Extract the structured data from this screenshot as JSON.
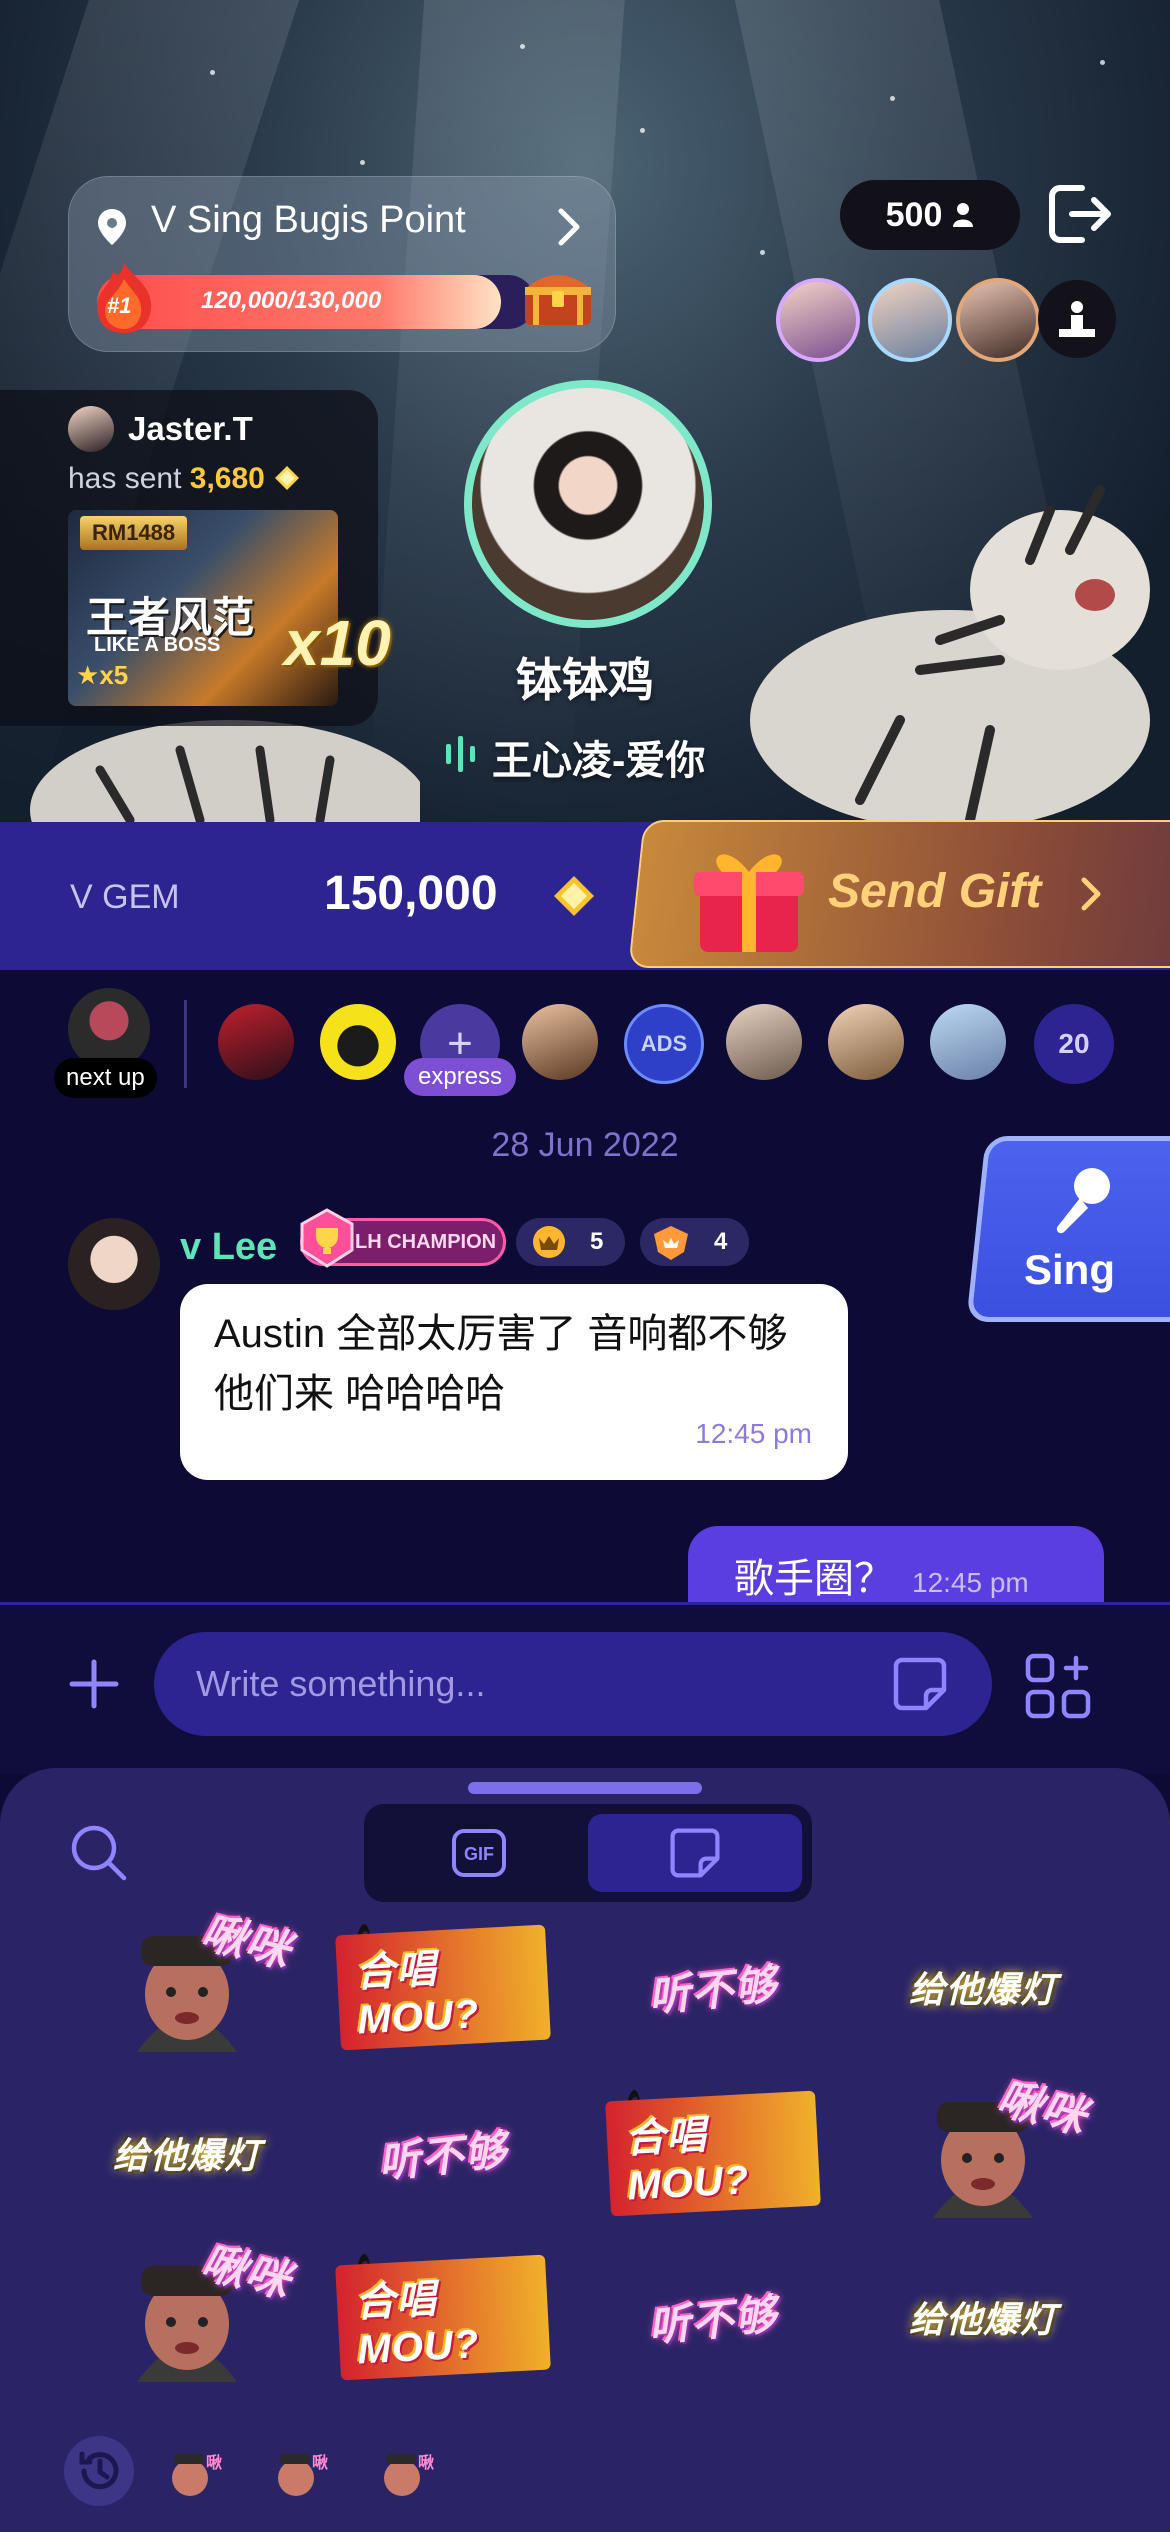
{
  "venue": {
    "name": "V Sing Bugis Point",
    "rank": "#1",
    "progress_text": "120,000/130,000",
    "progress_fraction": 0.923
  },
  "viewers": {
    "count": "500"
  },
  "gift_event": {
    "sender": "Jaster.T",
    "sent_prefix": "has sent",
    "amount": "3,680",
    "gift_badge": "RM1488",
    "gift_title": "王者风范",
    "gift_subtitle": "LIKE A BOSS",
    "gift_stars": "x5",
    "multiplier": "x10"
  },
  "host": {
    "name": "钵钵鸡",
    "song": "王心凌-爱你"
  },
  "gem_bar": {
    "label": "V GEM",
    "value": "150,000",
    "send_gift_label": "Send Gift"
  },
  "queue": {
    "next_up_label": "next up",
    "express_label": "express",
    "ads_label": "ADS",
    "count": "20"
  },
  "chat": {
    "date": "28 Jun 2022",
    "messages": [
      {
        "user": "v Lee",
        "badge_champion": "LH CHAMPION",
        "badge_1_count": "5",
        "badge_2_count": "4",
        "text": "Austin 全部太厉害了 音响都不够他们来 哈哈哈哈",
        "time": "12:45 pm"
      },
      {
        "text": "歌手圈？",
        "time": "12:45 pm"
      }
    ],
    "sing_label": "Sing"
  },
  "composer": {
    "placeholder": "Write something..."
  },
  "stickers": {
    "gif_label": "GIF",
    "items": [
      {
        "kind": "face",
        "text": "啾咪"
      },
      {
        "kind": "mou",
        "text": "合唱MOU?"
      },
      {
        "kind": "pink",
        "text": "听不够"
      },
      {
        "kind": "gold",
        "text": "给他爆灯"
      },
      {
        "kind": "gold",
        "text": "给他爆灯"
      },
      {
        "kind": "pink",
        "text": "听不够"
      },
      {
        "kind": "mou",
        "text": "合唱MOU?"
      },
      {
        "kind": "face",
        "text": "啾咪"
      },
      {
        "kind": "face",
        "text": "啾咪"
      },
      {
        "kind": "mou",
        "text": "合唱MOU?"
      },
      {
        "kind": "pink",
        "text": "听不够"
      },
      {
        "kind": "gold",
        "text": "给他爆灯"
      }
    ]
  },
  "colors": {
    "accent_purple": "#5b3ee0",
    "gem_bar": "#2c2490",
    "username_green": "#5fe3b9",
    "gold": "#ffc93d",
    "ring": "#7ee8c9"
  }
}
